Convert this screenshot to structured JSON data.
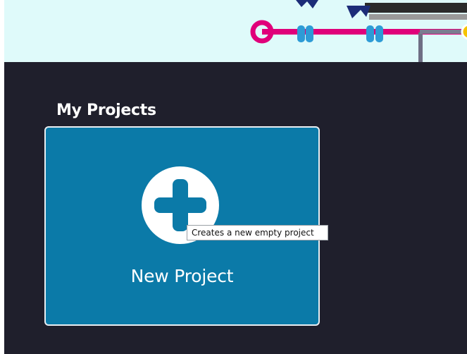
{
  "section": {
    "title": "My Projects"
  },
  "new_project_card": {
    "label": "New Project",
    "icon": "plus-circle-icon"
  },
  "tooltip": {
    "text": "Creates a new empty project"
  },
  "colors": {
    "banner_bg": "#dffafa",
    "page_bg": "#1f1f2c",
    "card_bg": "#0b7aa8",
    "accent_pink": "#e0007a",
    "accent_blue": "#2d9bd6"
  }
}
